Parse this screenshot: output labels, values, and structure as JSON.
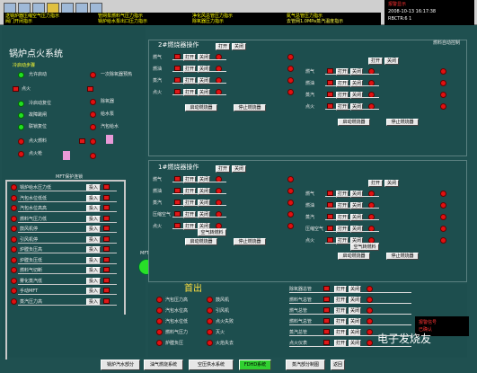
{
  "alarms": [
    "送锅炉器压缩空气压力指示",
    "管网泵燃料气压力指示",
    "净化风总管压力指示",
    "氮气总管压力指示",
    "阀门开闭指示",
    "锅炉给水泵出口压力指示",
    "除氧器压力指示",
    "去管网1.0MPa蒸汽温度指示"
  ],
  "datetime": [
    "报警显示",
    "2008-10-13 16:17:38",
    "RBCTR:6 1"
  ],
  "left": {
    "title": "锅炉点火系统",
    "sub": "冷启动步骤",
    "items": [
      "允许启动",
      "点火",
      "冷启动复位",
      "故障跳闸",
      "联锁复位"
    ],
    "mid": [
      "一次除氧器预热",
      "除氧器",
      "给水泵",
      "汽包给水",
      "点火燃料",
      "点火枪"
    ],
    "chain_title": "MFT保护连锁",
    "mft_items": [
      "锅炉给水压力低",
      "汽包水位低低",
      "汽包水位高高",
      "燃料气压力低",
      "鼓风机停",
      "引风机停",
      "炉膛负压高",
      "炉膛负压低",
      "燃料气切断",
      "雾化蒸汽低",
      "手动MFT",
      "蒸汽压力高"
    ],
    "mft_btn": "投入",
    "mft_ball": "MFT复位"
  },
  "upper": {
    "title": "2#燃烧器操作",
    "open": "打开",
    "close": "关闭",
    "rows": [
      "燃气",
      "燃油",
      "蒸汽",
      "点火"
    ],
    "start": "启动燃烧器",
    "stop": "停止燃烧器",
    "side": "燃料自动控制",
    "steam": "雾化蒸汽"
  },
  "lower": {
    "title": "1#燃烧器操作",
    "rows": [
      "燃气",
      "燃油",
      "蒸汽",
      "压缩空气",
      "点火"
    ],
    "pipe": "空气转燃料",
    "start": "启动燃烧器",
    "stop": "停止燃烧器"
  },
  "out": {
    "title": "首出",
    "items": [
      "汽包压力高",
      "汽包水位高",
      "汽包水位低",
      "燃料气压力",
      "炉膛负压",
      "鼓风机",
      "引风机",
      "点火失败",
      "灭火",
      "火焰失去"
    ],
    "right": [
      "除氧器总管",
      "燃料气总管",
      "燃气总管",
      "燃料气总管",
      "蒸汽总管",
      "点火仪表"
    ],
    "cmd": [
      "报警信号",
      "已确认"
    ]
  },
  "bottom": [
    "锅炉汽水部分",
    "油气燃烧系统",
    "空压供水系统",
    "FDHD系统",
    "蒸汽部分制图",
    "返回"
  ],
  "watermark": "电子发烧友"
}
